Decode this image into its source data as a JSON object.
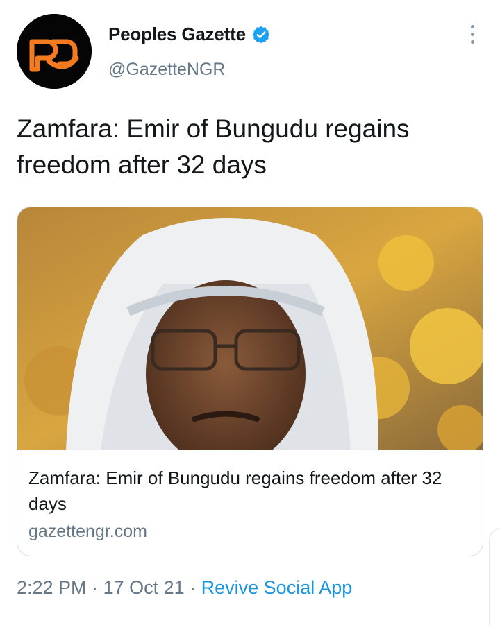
{
  "account": {
    "avatar_text": "pg",
    "name": "Peoples Gazette",
    "handle": "@GazetteNGR",
    "verified_icon": "verified-badge-icon",
    "menu_icon": "more-vertical-icon"
  },
  "tweet": {
    "text": "Zamfara: Emir of Bungudu regains freedom after 32 days"
  },
  "card": {
    "image_icon": "photo-emir-portrait",
    "title": "Zamfara: Emir of Bungudu regains freedom after 32 days",
    "domain": "gazettengr.com"
  },
  "meta": {
    "time": "2:22 PM",
    "separator1": " · ",
    "date": "17 Oct 21",
    "separator2": " · ",
    "source": "Revive Social App"
  },
  "colors": {
    "accent": "#1b95e0",
    "brand_orange": "#f47a20",
    "secondary_text": "#657786"
  }
}
